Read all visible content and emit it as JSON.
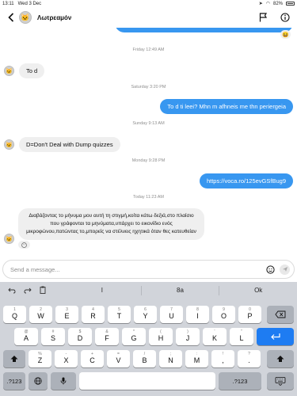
{
  "status": {
    "time": "13:11",
    "date": "Wed 3 Dec",
    "battery": "82%"
  },
  "header": {
    "contact_name": "Λωτρεαμόν"
  },
  "chat": {
    "ts1": "Friday 12:49 AM",
    "m1": "To d",
    "ts2": "Saturday 3:20 PM",
    "m2": "To d ti leei? Mhn m afhneis me thn periergeia",
    "ts3": "Sunday 9:13 AM",
    "m3": "D=Don't Deal with Dump quizzes",
    "ts4": "Monday 9:28 PM",
    "m4": "https://voca.ro/125evGSfBug9",
    "ts5": "Today 11:23 AM",
    "m5": "Διαβάζοντας το μήνυμα μου αυτή τη στιγμή,κοίτα κάτω δεξιά,στο πλαίσιο που γράφονται τα μηνύματα,υπάρχει το εικονίδιο ενός μικροφώνου,πατώντας το,μπορείς να στέλνεις ηχητικά όταν θες κατευθείαν"
  },
  "composer": {
    "placeholder": "Send a message..."
  },
  "keyboard": {
    "suggestions": [
      "I",
      "8a",
      "Ok"
    ],
    "row1": [
      {
        "main": "Q",
        "sub": "1"
      },
      {
        "main": "W",
        "sub": "2"
      },
      {
        "main": "E",
        "sub": "3"
      },
      {
        "main": "R",
        "sub": "4"
      },
      {
        "main": "T",
        "sub": "5"
      },
      {
        "main": "Y",
        "sub": "6"
      },
      {
        "main": "U",
        "sub": "7"
      },
      {
        "main": "I",
        "sub": "8"
      },
      {
        "main": "O",
        "sub": "9"
      },
      {
        "main": "P",
        "sub": "0"
      }
    ],
    "row2": [
      {
        "main": "A",
        "sub": "@"
      },
      {
        "main": "S",
        "sub": "#"
      },
      {
        "main": "D",
        "sub": "$"
      },
      {
        "main": "F",
        "sub": "&"
      },
      {
        "main": "G",
        "sub": "*"
      },
      {
        "main": "H",
        "sub": "("
      },
      {
        "main": "J",
        "sub": ")"
      },
      {
        "main": "K",
        "sub": "'"
      },
      {
        "main": "L",
        "sub": "\""
      }
    ],
    "row3": [
      {
        "main": "Z",
        "sub": "%"
      },
      {
        "main": "X",
        "sub": "-"
      },
      {
        "main": "C",
        "sub": "+"
      },
      {
        "main": "V",
        "sub": "="
      },
      {
        "main": "B",
        "sub": "/"
      },
      {
        "main": "N",
        "sub": ";"
      },
      {
        "main": "M",
        "sub": ":"
      },
      {
        "main": ",",
        "sub": "!"
      },
      {
        "main": ".",
        "sub": "?"
      }
    ],
    "num_label": ".?123"
  },
  "colors": {
    "accent": "#3897f0",
    "keyboard_bg": "#d1d4da",
    "return_key": "#1e7cf2"
  }
}
